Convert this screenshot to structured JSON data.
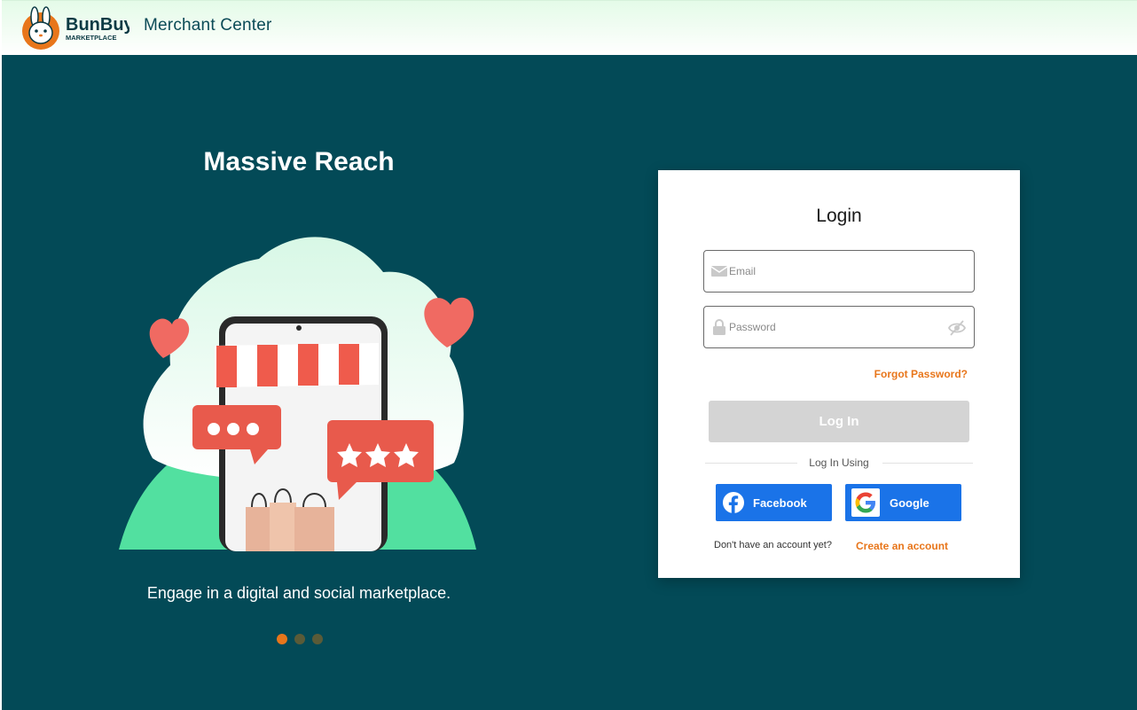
{
  "header": {
    "logo_text": "BunBuy",
    "logo_subtext": "MARKETPLACE",
    "title": "Merchant Center"
  },
  "hero": {
    "title": "Massive Reach",
    "caption": "Engage in a digital and social marketplace.",
    "carousel": {
      "count": 3,
      "active_index": 0
    }
  },
  "login": {
    "title": "Login",
    "email_placeholder": "Email",
    "password_placeholder": "Password",
    "forgot_label": "Forgot Password?",
    "submit_label": "Log In",
    "divider_label": "Log In Using",
    "facebook_label": "Facebook",
    "google_label": "Google",
    "signup_question": "Don't have an account yet?",
    "signup_link": "Create an account"
  },
  "colors": {
    "teal": "#034a57",
    "accent_orange": "#e8761b",
    "button_blue": "#1a73e8",
    "disabled_gray": "#d4d4d4"
  },
  "icons": {
    "email": "mail-icon",
    "password": "lock-icon",
    "toggle": "eye-off-icon",
    "facebook": "facebook-icon",
    "google": "google-icon"
  }
}
